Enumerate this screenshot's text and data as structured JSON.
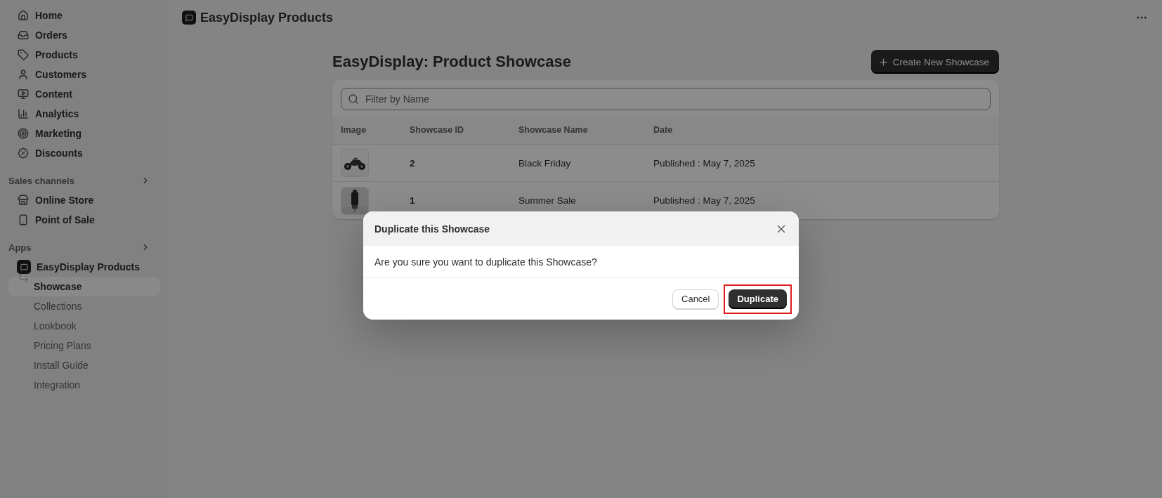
{
  "sidebar": {
    "main_items": [
      {
        "label": "Home"
      },
      {
        "label": "Orders"
      },
      {
        "label": "Products"
      },
      {
        "label": "Customers"
      },
      {
        "label": "Content"
      },
      {
        "label": "Analytics"
      },
      {
        "label": "Marketing"
      },
      {
        "label": "Discounts"
      }
    ],
    "sections": [
      {
        "title": "Sales channels",
        "items": [
          {
            "label": "Online Store"
          },
          {
            "label": "Point of Sale"
          }
        ]
      },
      {
        "title": "Apps",
        "items": [
          {
            "label": "EasyDisplay Products",
            "children": [
              {
                "label": "Showcase",
                "selected": true
              },
              {
                "label": "Collections",
                "selected": false
              },
              {
                "label": "Lookbook",
                "selected": false
              },
              {
                "label": "Pricing Plans",
                "selected": false
              },
              {
                "label": "Install Guide",
                "selected": false
              },
              {
                "label": "Integration",
                "selected": false
              }
            ]
          }
        ]
      }
    ]
  },
  "app_header": {
    "title": "EasyDisplay Products"
  },
  "page": {
    "title": "EasyDisplay: Product Showcase",
    "create_button": "Create New Showcase",
    "search": {
      "placeholder": "Filter by Name"
    },
    "table": {
      "columns": [
        "Image",
        "Showcase ID",
        "Showcase Name",
        "Date"
      ],
      "rows": [
        {
          "id": "2",
          "name": "Black Friday",
          "date": "Published : May 7, 2025"
        },
        {
          "id": "1",
          "name": "Summer Sale",
          "date": "Published : May 7, 2025"
        }
      ]
    }
  },
  "dialog": {
    "title": "Duplicate this Showcase",
    "message": "Are you sure you want to duplicate this Showcase?",
    "buttons": [
      {
        "label": "Cancel",
        "kind": "secondary",
        "highlighted": false
      },
      {
        "label": "Duplicate",
        "kind": "primary",
        "highlighted": true
      }
    ]
  }
}
